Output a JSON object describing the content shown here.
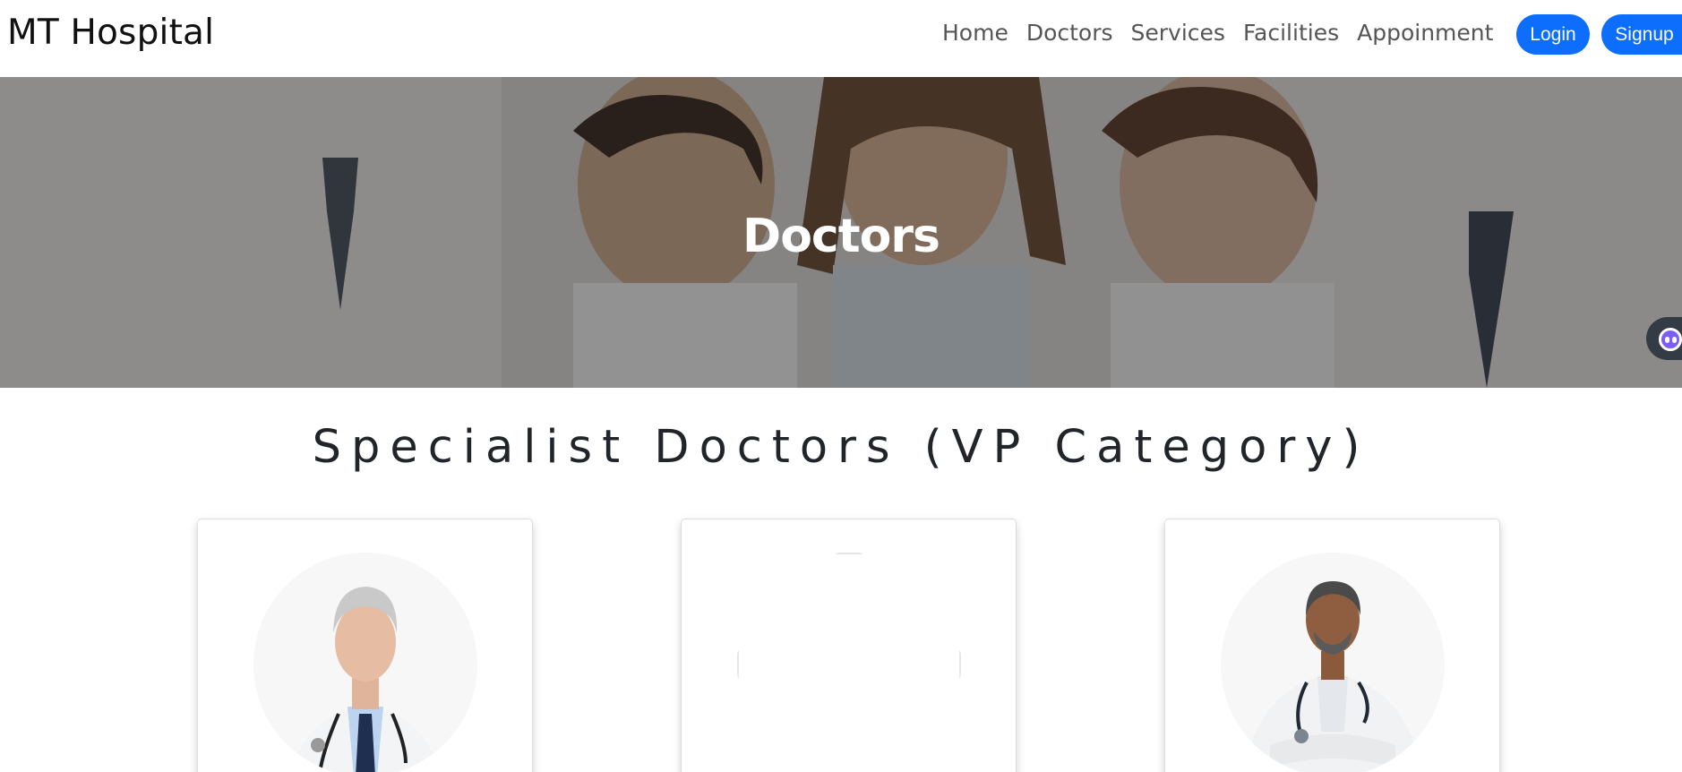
{
  "brand": "MT Hospital",
  "nav": {
    "links": [
      "Home",
      "Doctors",
      "Services",
      "Facilities",
      "Appoinment"
    ],
    "login_label": "Login",
    "signup_label": "Signup"
  },
  "hero": {
    "title": "Doctors"
  },
  "section": {
    "title": "Specialist Doctors (VP Category)"
  },
  "colors": {
    "primary": "#0d6efd",
    "hero_overlay": "#141414",
    "chat_widget": "#7b5cff"
  },
  "icons": {
    "chat": "chatbot-icon"
  }
}
